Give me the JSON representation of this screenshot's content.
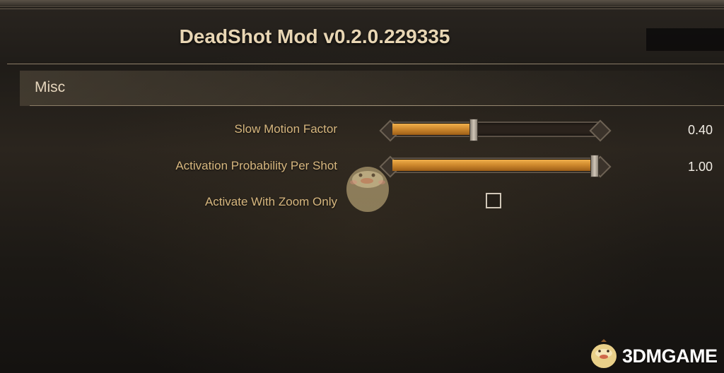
{
  "header": {
    "title": "DeadShot Mod v0.2.0.229335"
  },
  "section": {
    "title": "Misc"
  },
  "settings": [
    {
      "label": "Slow Motion Factor",
      "value_text": "0.40",
      "level": 0.4
    },
    {
      "label": "Activation Probability Per Shot",
      "value_text": "1.00",
      "level": 1.0
    },
    {
      "label": "Activate With Zoom Only",
      "checked": false
    }
  ],
  "watermark": {
    "text": "3DMGAME",
    "mascot_icon": "mascot-bird-icon"
  },
  "colors": {
    "accent_fill": "#d08a2e",
    "label_text": "#d7b77f",
    "title_text": "#e8d6b4"
  }
}
